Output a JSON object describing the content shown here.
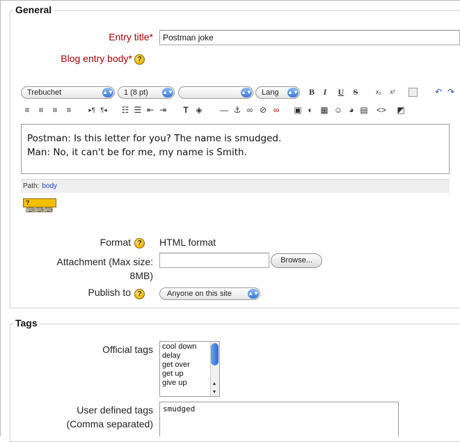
{
  "general": {
    "legend": "General",
    "entry_title_label": "Entry title",
    "entry_title_value": "Postman joke",
    "blog_body_label": "Blog entry body",
    "required_mark": "*",
    "help_glyph": "?"
  },
  "editor": {
    "font_select": "Trebuchet",
    "size_select": "1 (8 pt)",
    "style_select": "",
    "lang_select": "Lang",
    "bold": "B",
    "italic": "I",
    "underline": "U",
    "strike": "S",
    "subscript": "x₂",
    "superscript": "x²",
    "content_line1": "Postman: Is this letter for you? The name is smudged.",
    "content_line2": "Man: No, it can't be for me, my name is Smith.",
    "path_label": "Path:",
    "path_value": "body",
    "keyboard_help_label": "? ⌨⌨⌨",
    "toolbar_icons": [
      "paste-word-icon",
      "undo-icon",
      "redo-icon",
      "align-left-icon",
      "align-center-icon",
      "align-right-icon",
      "justify-icon",
      "ltr-icon",
      "rtl-icon",
      "ordered-list-icon",
      "unordered-list-icon",
      "outdent-icon",
      "indent-icon",
      "text-color-icon",
      "background-color-icon",
      "horizontal-rule-icon",
      "anchor-icon",
      "link-icon",
      "unlink-icon",
      "nolink-icon",
      "image-icon",
      "media-icon",
      "table-icon",
      "smiley-icon",
      "emoticon-icon",
      "special-char-icon",
      "html-source-icon",
      "fullscreen-icon"
    ]
  },
  "format": {
    "label": "Format",
    "value": "HTML format"
  },
  "attachment": {
    "label_line1": "Attachment (Max size:",
    "label_line2": "8MB)",
    "value": "",
    "browse_label": "Browse..."
  },
  "publish": {
    "label": "Publish to",
    "value": "Anyone on this site"
  },
  "tags": {
    "legend": "Tags",
    "official_label": "Official tags",
    "official_options": [
      "cool down",
      "delay",
      "get over",
      "get up",
      "give up"
    ],
    "user_defined_label_line1": "User defined tags",
    "user_defined_label_line2": "(Comma separated)",
    "user_defined_value": "smudged"
  },
  "colors": {
    "required": "#a60000",
    "help_icon": "#e9b600",
    "select_accent": "#3a78d6",
    "path_link": "#1a46b8"
  }
}
